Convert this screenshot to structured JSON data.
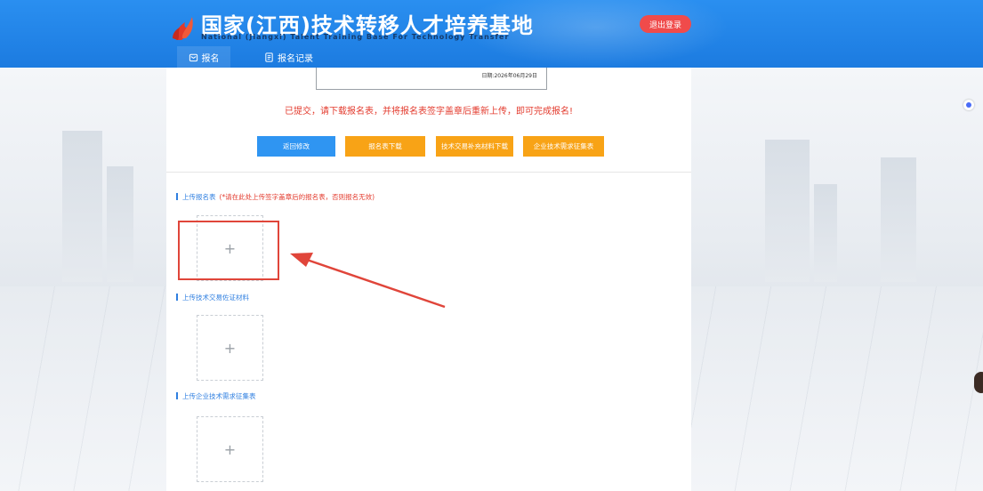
{
  "header": {
    "title": "国家(江西)技术转移人才培养基地",
    "subtitle": "National (Jiangxi) Talent Training Base For Technology Transfer",
    "logout_label": "退出登录",
    "logo_icon": "flame-logo-icon",
    "colors": {
      "header_blue": "#1c7be0",
      "logout_red": "#f04b4b"
    }
  },
  "nav": {
    "tabs": [
      {
        "label": "报名",
        "icon": "form-icon",
        "active": true
      },
      {
        "label": "报名记录",
        "icon": "document-icon",
        "active": false
      }
    ]
  },
  "main": {
    "preview_date": "日期:2026年06月29日",
    "notice": "已提交，请下载报名表，并将报名表签字盖章后重新上传，即可完成报名!",
    "buttons": {
      "back_edit": "返回修改",
      "download_form": "报名表下载",
      "download_supplement": "技术交易补充材料下载",
      "demand_form": "企业技术需求征集表"
    },
    "sections": [
      {
        "label": "上传报名表",
        "note": "(*请在此处上传签字盖章后的报名表，否则报名无效)"
      },
      {
        "label": "上传技术交易佐证材料",
        "note": ""
      },
      {
        "label": "上传企业技术需求征集表",
        "note": ""
      }
    ],
    "upload_plus": "+",
    "colors": {
      "button_blue": "#2f95f2",
      "button_orange": "#f8a316",
      "notice_red": "#e33b2e",
      "highlight_red": "#e0453a"
    }
  }
}
